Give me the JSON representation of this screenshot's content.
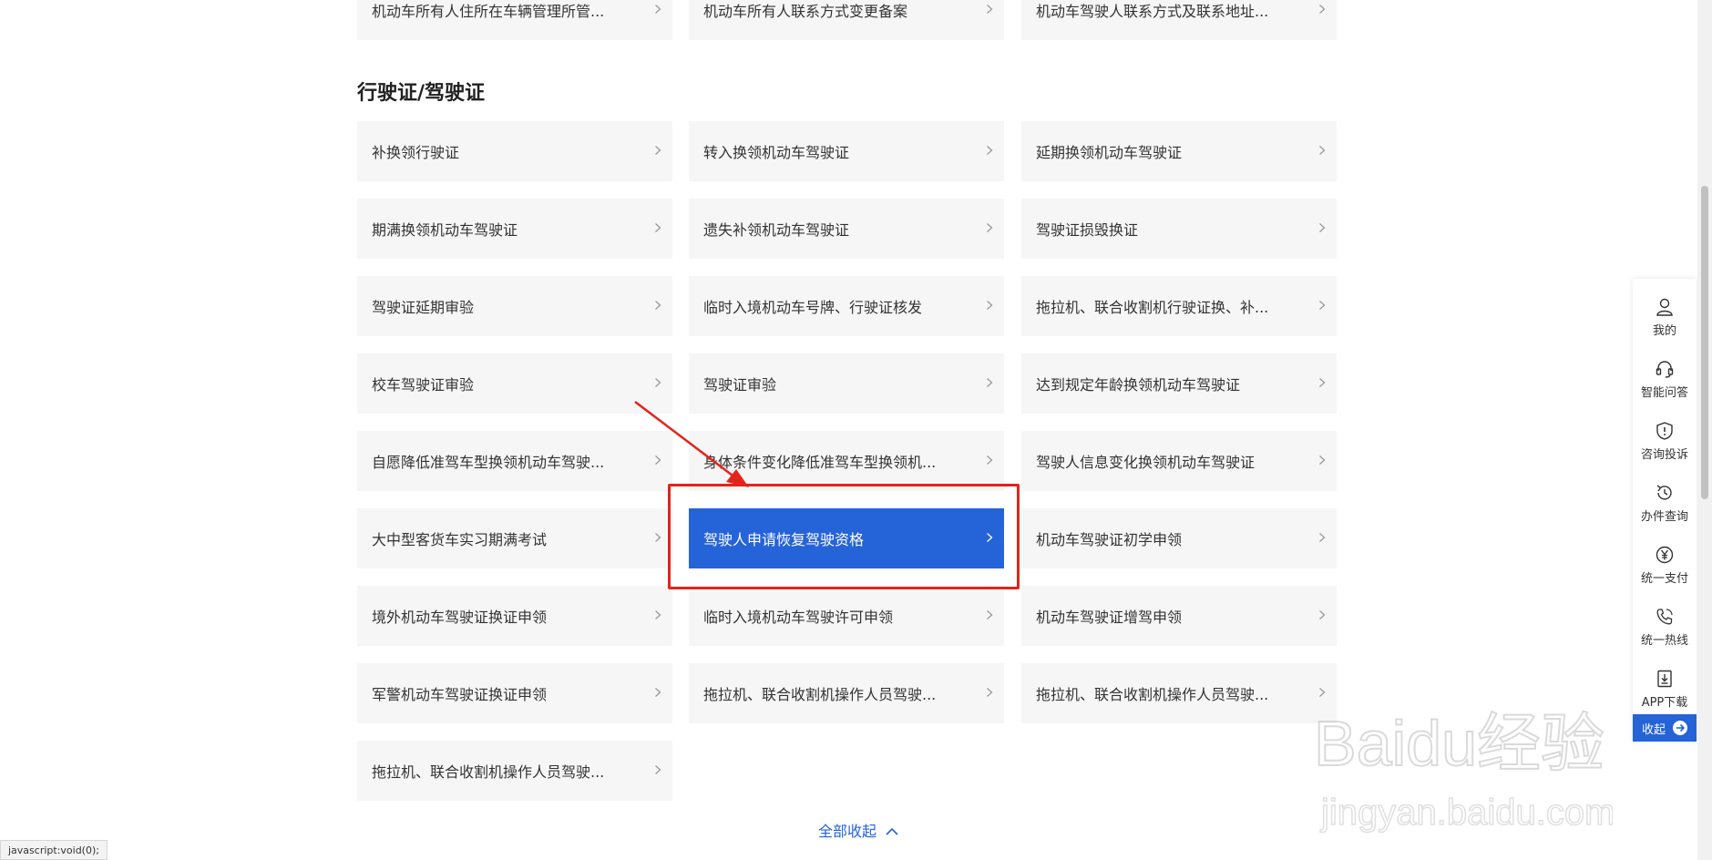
{
  "top_row": [
    {
      "label": "机动车所有人住所在车辆管理所管..."
    },
    {
      "label": "机动车所有人联系方式变更备案"
    },
    {
      "label": "机动车驾驶人联系方式及联系地址..."
    }
  ],
  "section": {
    "title": "行驶证/驾驶证",
    "items": [
      {
        "label": "补换领行驶证"
      },
      {
        "label": "转入换领机动车驾驶证"
      },
      {
        "label": "延期换领机动车驾驶证"
      },
      {
        "label": "期满换领机动车驾驶证"
      },
      {
        "label": "遗失补领机动车驾驶证"
      },
      {
        "label": "驾驶证损毁换证"
      },
      {
        "label": "驾驶证延期审验"
      },
      {
        "label": "临时入境机动车号牌、行驶证核发"
      },
      {
        "label": "拖拉机、联合收割机行驶证换、补..."
      },
      {
        "label": "校车驾驶证审验"
      },
      {
        "label": "驾驶证审验"
      },
      {
        "label": "达到规定年龄换领机动车驾驶证"
      },
      {
        "label": "自愿降低准驾车型换领机动车驾驶..."
      },
      {
        "label": "身体条件变化降低准驾车型换领机..."
      },
      {
        "label": "驾驶人信息变化换领机动车驾驶证"
      },
      {
        "label": "大中型客货车实习期满考试"
      },
      {
        "label": "驾驶人申请恢复驾驶资格"
      },
      {
        "label": "机动车驾驶证初学申领"
      },
      {
        "label": "境外机动车驾驶证换证申领"
      },
      {
        "label": "临时入境机动车驾驶许可申领"
      },
      {
        "label": "机动车驾驶证增驾申领"
      },
      {
        "label": "军警机动车驾驶证换证申领"
      },
      {
        "label": "拖拉机、联合收割机操作人员驾驶..."
      },
      {
        "label": "拖拉机、联合收割机操作人员驾驶..."
      },
      {
        "label": "拖拉机、联合收割机操作人员驾驶..."
      }
    ],
    "active_index": 16,
    "collapse_label": "全部收起"
  },
  "sidebar": {
    "items": [
      {
        "label": "我的",
        "icon": "user-icon"
      },
      {
        "label": "智能问答",
        "icon": "headset-icon"
      },
      {
        "label": "咨询投诉",
        "icon": "shield-alert-icon"
      },
      {
        "label": "办件查询",
        "icon": "history-icon"
      },
      {
        "label": "统一支付",
        "icon": "yuan-icon"
      },
      {
        "label": "统一热线",
        "icon": "phone-icon"
      },
      {
        "label": "APP下载",
        "icon": "download-icon"
      }
    ],
    "collapse_label": "收起"
  },
  "status_bar": {
    "text": "javascript:void(0);"
  },
  "watermark": {
    "brand": "Baidu经验",
    "url": "jingyan.baidu.com"
  },
  "colors": {
    "accent": "#2563d8",
    "card_bg": "#f6f6f6",
    "highlight": "#e4231c"
  }
}
